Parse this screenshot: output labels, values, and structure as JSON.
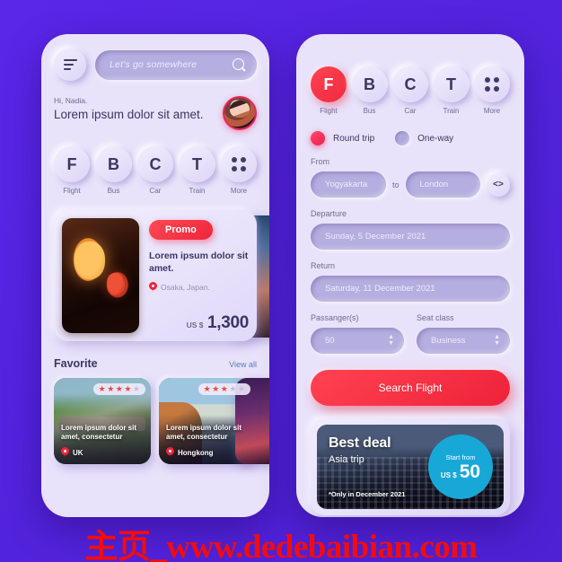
{
  "background_color": "#5423e0",
  "watermark": "主页_www.dedebaibian.com",
  "left_phone": {
    "menu_icon": "hamburger-icon",
    "search": {
      "placeholder": "Let's go somewhere",
      "icon": "search-icon"
    },
    "greeting": {
      "hi": "Hi, Nadia.",
      "headline": "Lorem ipsum dolor sit amet."
    },
    "avatar": "user-avatar",
    "categories": [
      {
        "initial": "F",
        "label": "Flight",
        "active": false
      },
      {
        "initial": "B",
        "label": "Bus",
        "active": false
      },
      {
        "initial": "C",
        "label": "Car",
        "active": false
      },
      {
        "initial": "T",
        "label": "Train",
        "active": false
      },
      {
        "initial": "",
        "label": "More",
        "active": false,
        "icon": "four-dots-icon"
      }
    ],
    "promo": {
      "badge": "Promo",
      "title": "Lorem ipsum dolor sit amet.",
      "location": "Osaka, Japan.",
      "currency": "US $",
      "price": "1,300"
    },
    "favorite": {
      "title": "Favorite",
      "view_all": "View all",
      "cards": [
        {
          "caption": "Lorem ipsum dolor sit amet, consectetur",
          "location": "UK",
          "rating": 4,
          "max_rating": 5
        },
        {
          "caption": "Lorem ipsum dolor sit amet, consectetur",
          "location": "Hongkong",
          "rating": 3,
          "max_rating": 5
        }
      ]
    }
  },
  "right_phone": {
    "categories": [
      {
        "initial": "F",
        "label": "Flight",
        "active": true
      },
      {
        "initial": "B",
        "label": "Bus",
        "active": false
      },
      {
        "initial": "C",
        "label": "Car",
        "active": false
      },
      {
        "initial": "T",
        "label": "Train",
        "active": false
      },
      {
        "initial": "",
        "label": "More",
        "active": false,
        "icon": "four-dots-icon"
      }
    ],
    "trip_type": {
      "round_trip_label": "Round trip",
      "one_way_label": "One-way",
      "selected": "Round trip"
    },
    "from_label": "From",
    "origin": "Yogyakarta",
    "to_label": "to",
    "destination": "London",
    "swap_icon": "swap-arrows-icon",
    "departure_label": "Departure",
    "departure_value": "Sunday, 5 December 2021",
    "return_label": "Return",
    "return_value": "Saturday, 11 December 2021",
    "passenger_label": "Passanger(s)",
    "passenger_value": "50",
    "seat_class_label": "Seat class",
    "seat_class_value": "Business",
    "search_button": "Search Flight",
    "deal": {
      "title": "Best deal",
      "subtitle": "Asia trip",
      "note": "*Only in December 2021",
      "badge_top": "Start from",
      "badge_currency": "US $",
      "badge_amount": "50",
      "badge_color": "#18a8d8"
    }
  }
}
